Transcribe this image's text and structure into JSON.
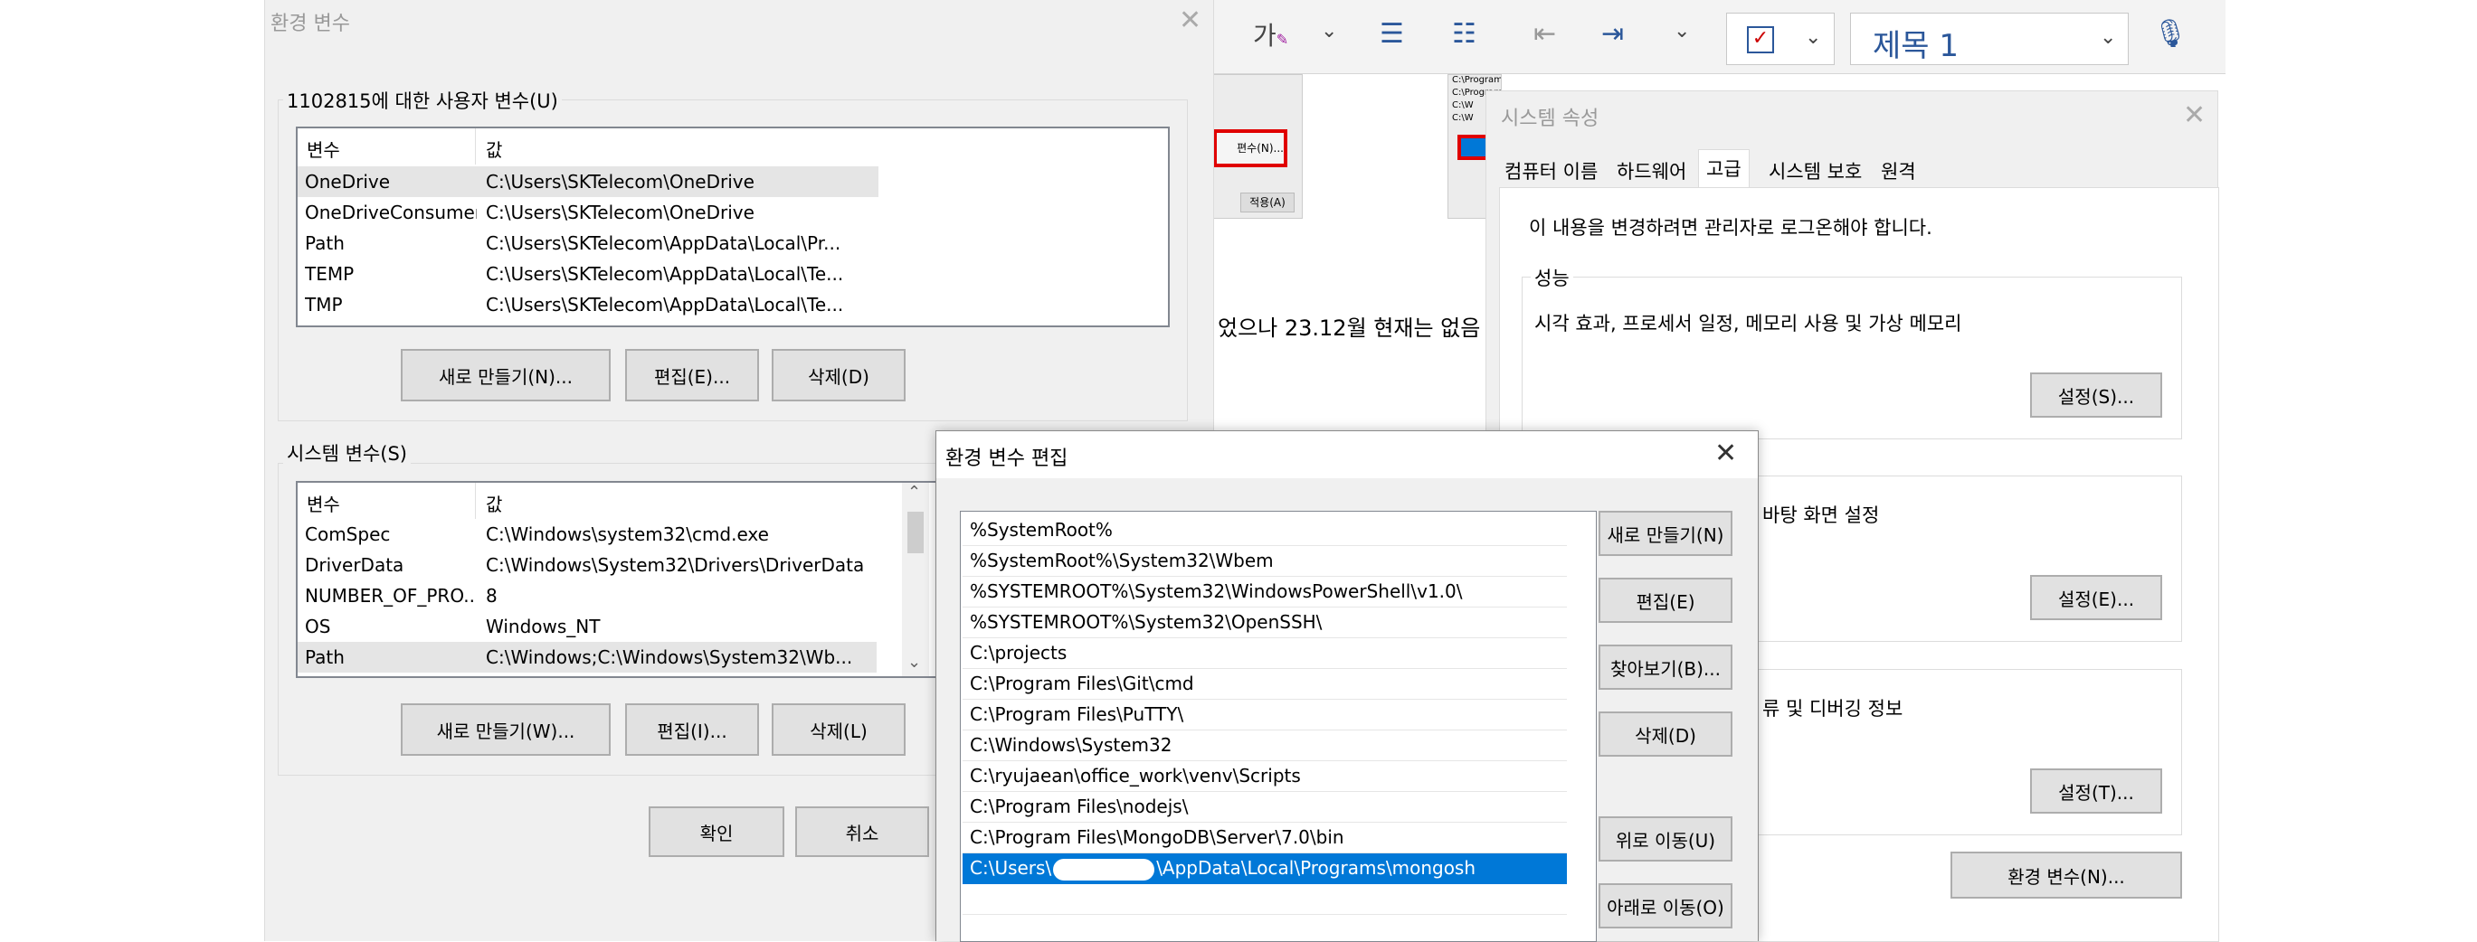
{
  "ribbon": {
    "char_icon_label": "가",
    "style_name": "제목 1"
  },
  "bg_doc": {
    "partial_text": "었으나 23.12월 현재는 없음",
    "thumb_left_btn": "편수(N)...",
    "thumb_left_btn2": "적용(A)",
    "thumb_right_lines": [
      "C:\\Program Files\\Git\\cmd",
      "C:\\Program Files\\nodejs\\",
      "C:\\W",
      "C:\\W",
      "C:\\W"
    ]
  },
  "env_vars": {
    "title": "환경 변수",
    "user_group_label": "1102815에 대한 사용자 변수(U)",
    "col_var": "변수",
    "col_val": "값",
    "user_vars": [
      {
        "name": "OneDrive",
        "value": "C:\\Users\\SKTelecom\\OneDrive"
      },
      {
        "name": "OneDriveConsumer",
        "value": "C:\\Users\\SKTelecom\\OneDrive"
      },
      {
        "name": "Path",
        "value": "C:\\Users\\SKTelecom\\AppData\\Local\\Pr..."
      },
      {
        "name": "TEMP",
        "value": "C:\\Users\\SKTelecom\\AppData\\Local\\Te..."
      },
      {
        "name": "TMP",
        "value": "C:\\Users\\SKTelecom\\AppData\\Local\\Te..."
      }
    ],
    "user_new": "새로 만들기(N)...",
    "user_edit": "편집(E)...",
    "user_delete": "삭제(D)",
    "sys_group_label": "시스템 변수(S)",
    "sys_vars": [
      {
        "name": "ComSpec",
        "value": "C:\\Windows\\system32\\cmd.exe"
      },
      {
        "name": "DriverData",
        "value": "C:\\Windows\\System32\\Drivers\\DriverData"
      },
      {
        "name": "NUMBER_OF_PRO...",
        "value": "8"
      },
      {
        "name": "OS",
        "value": "Windows_NT"
      },
      {
        "name": "Path",
        "value": "C:\\Windows;C:\\Windows\\System32\\Wb..."
      }
    ],
    "sys_new": "새로 만들기(W)...",
    "sys_edit": "편집(I)...",
    "sys_delete": "삭제(L)",
    "ok": "확인",
    "cancel": "취소"
  },
  "sys_props": {
    "title": "시스템 속성",
    "tabs": [
      "컴퓨터 이름",
      "하드웨어",
      "고급",
      "시스템 보호",
      "원격"
    ],
    "admin_note": "이 내용을 변경하려면 관리자로 로그온해야 합니다.",
    "perf_label": "성능",
    "perf_desc": "시각 효과, 프로세서 일정, 메모리 사용 및 가상 메모리",
    "perf_settings": "설정(S)...",
    "profile_desc_partial": "바탕 화면 설정",
    "profile_settings": "설정(E)...",
    "startup_desc_partial": "류 및 디버깅 정보",
    "startup_settings": "설정(T)...",
    "env_button": "환경 변수(N)..."
  },
  "edit_env": {
    "title": "환경 변수 편집",
    "paths": [
      "%SystemRoot%",
      "%SystemRoot%\\System32\\Wbem",
      "%SYSTEMROOT%\\System32\\WindowsPowerShell\\v1.0\\",
      "%SYSTEMROOT%\\System32\\OpenSSH\\",
      "C:\\projects",
      "C:\\Program Files\\Git\\cmd",
      "C:\\Program Files\\PuTTY\\",
      "C:\\Windows\\System32",
      "C:\\ryujaean\\office_work\\venv\\Scripts",
      "C:\\Program Files\\nodejs\\",
      "C:\\Program Files\\MongoDB\\Server\\7.0\\bin"
    ],
    "selected_prefix": "C:\\Users\\",
    "selected_suffix": "\\AppData\\Local\\Programs\\mongosh",
    "new": "새로 만들기(N)",
    "edit": "편집(E)",
    "browse": "찾아보기(B)...",
    "delete": "삭제(D)",
    "move_up": "위로 이동(U)",
    "move_down": "아래로 이동(O)"
  }
}
